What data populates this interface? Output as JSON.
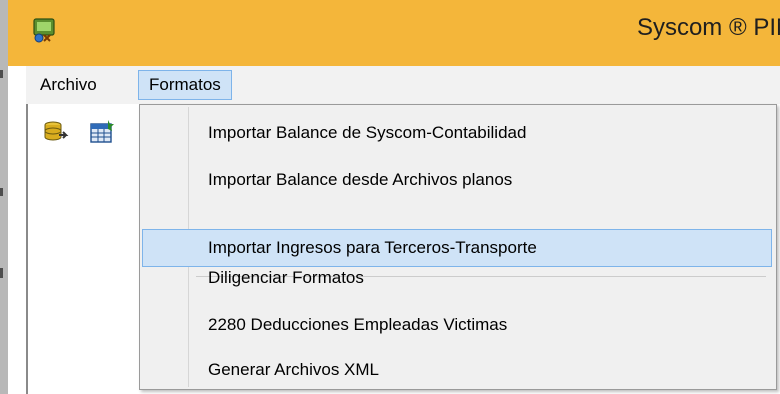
{
  "window": {
    "title": "Syscom ® PIM"
  },
  "menubar": {
    "items": [
      {
        "label": "Archivo"
      },
      {
        "label": "Formatos"
      }
    ]
  },
  "toolbar": {
    "icons": [
      "database-icon",
      "table-form-icon"
    ]
  },
  "dropdown": {
    "items": [
      {
        "label": "Importar Balance de Syscom-Contabilidad"
      },
      {
        "label": "Importar Balance desde Archivos planos"
      },
      {
        "label": "Importar Ingresos para Terceros-Transporte",
        "highlighted": true
      },
      {
        "label": "Diligenciar Formatos"
      },
      {
        "label": "2280 Deducciones Empleadas Victimas"
      },
      {
        "label": "Generar Archivos XML"
      }
    ]
  },
  "colors": {
    "titlebar": "#f4b63a",
    "highlight": "#cfe3f7",
    "highlight_border": "#7eb4ea",
    "menu_bg": "#f0f0f0"
  }
}
